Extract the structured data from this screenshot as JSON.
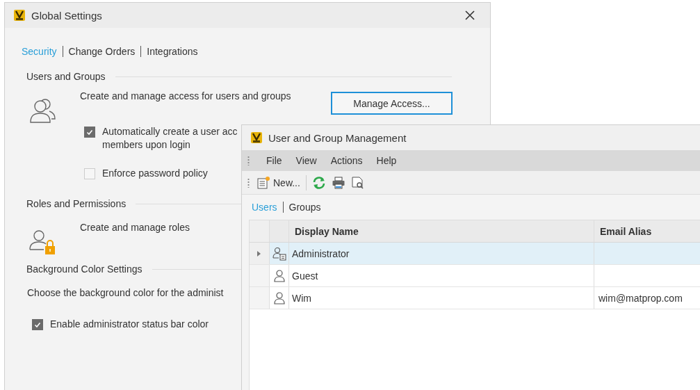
{
  "settings_window": {
    "title": "Global Settings",
    "tabs": [
      {
        "label": "Security",
        "selected": true
      },
      {
        "label": "Change Orders",
        "selected": false
      },
      {
        "label": "Integrations",
        "selected": false
      }
    ],
    "users_and_groups": {
      "heading": "Users and Groups",
      "description": "Create and manage access for users and groups",
      "button": "Manage Access...",
      "options": [
        {
          "label": "Automatically create a user acc",
          "label_line2": "members upon login",
          "checked": true
        },
        {
          "label": "Enforce password policy",
          "checked": false
        }
      ]
    },
    "roles_and_permissions": {
      "heading": "Roles and Permissions",
      "description": "Create and manage roles"
    },
    "background_color": {
      "heading": "Background Color Settings",
      "description": "Choose the background color for the administ",
      "option": {
        "label": "Enable administrator status bar color",
        "checked": true
      }
    }
  },
  "management_window": {
    "title": "User and Group Management",
    "menu": [
      "File",
      "View",
      "Actions",
      "Help"
    ],
    "toolbar": {
      "new_button": "New..."
    },
    "tabs": [
      {
        "label": "Users",
        "selected": true
      },
      {
        "label": "Groups",
        "selected": false
      }
    ],
    "table": {
      "columns": [
        "Display Name",
        "Email Alias"
      ],
      "rows": [
        {
          "kind": "group",
          "display_name": "Administrator",
          "email_alias": "",
          "selected": true,
          "expandable": true
        },
        {
          "kind": "user",
          "display_name": "Guest",
          "email_alias": "",
          "selected": false,
          "expandable": false
        },
        {
          "kind": "user",
          "display_name": "Wim",
          "email_alias": "wim@matprop.com",
          "selected": false,
          "expandable": false
        }
      ]
    }
  }
}
